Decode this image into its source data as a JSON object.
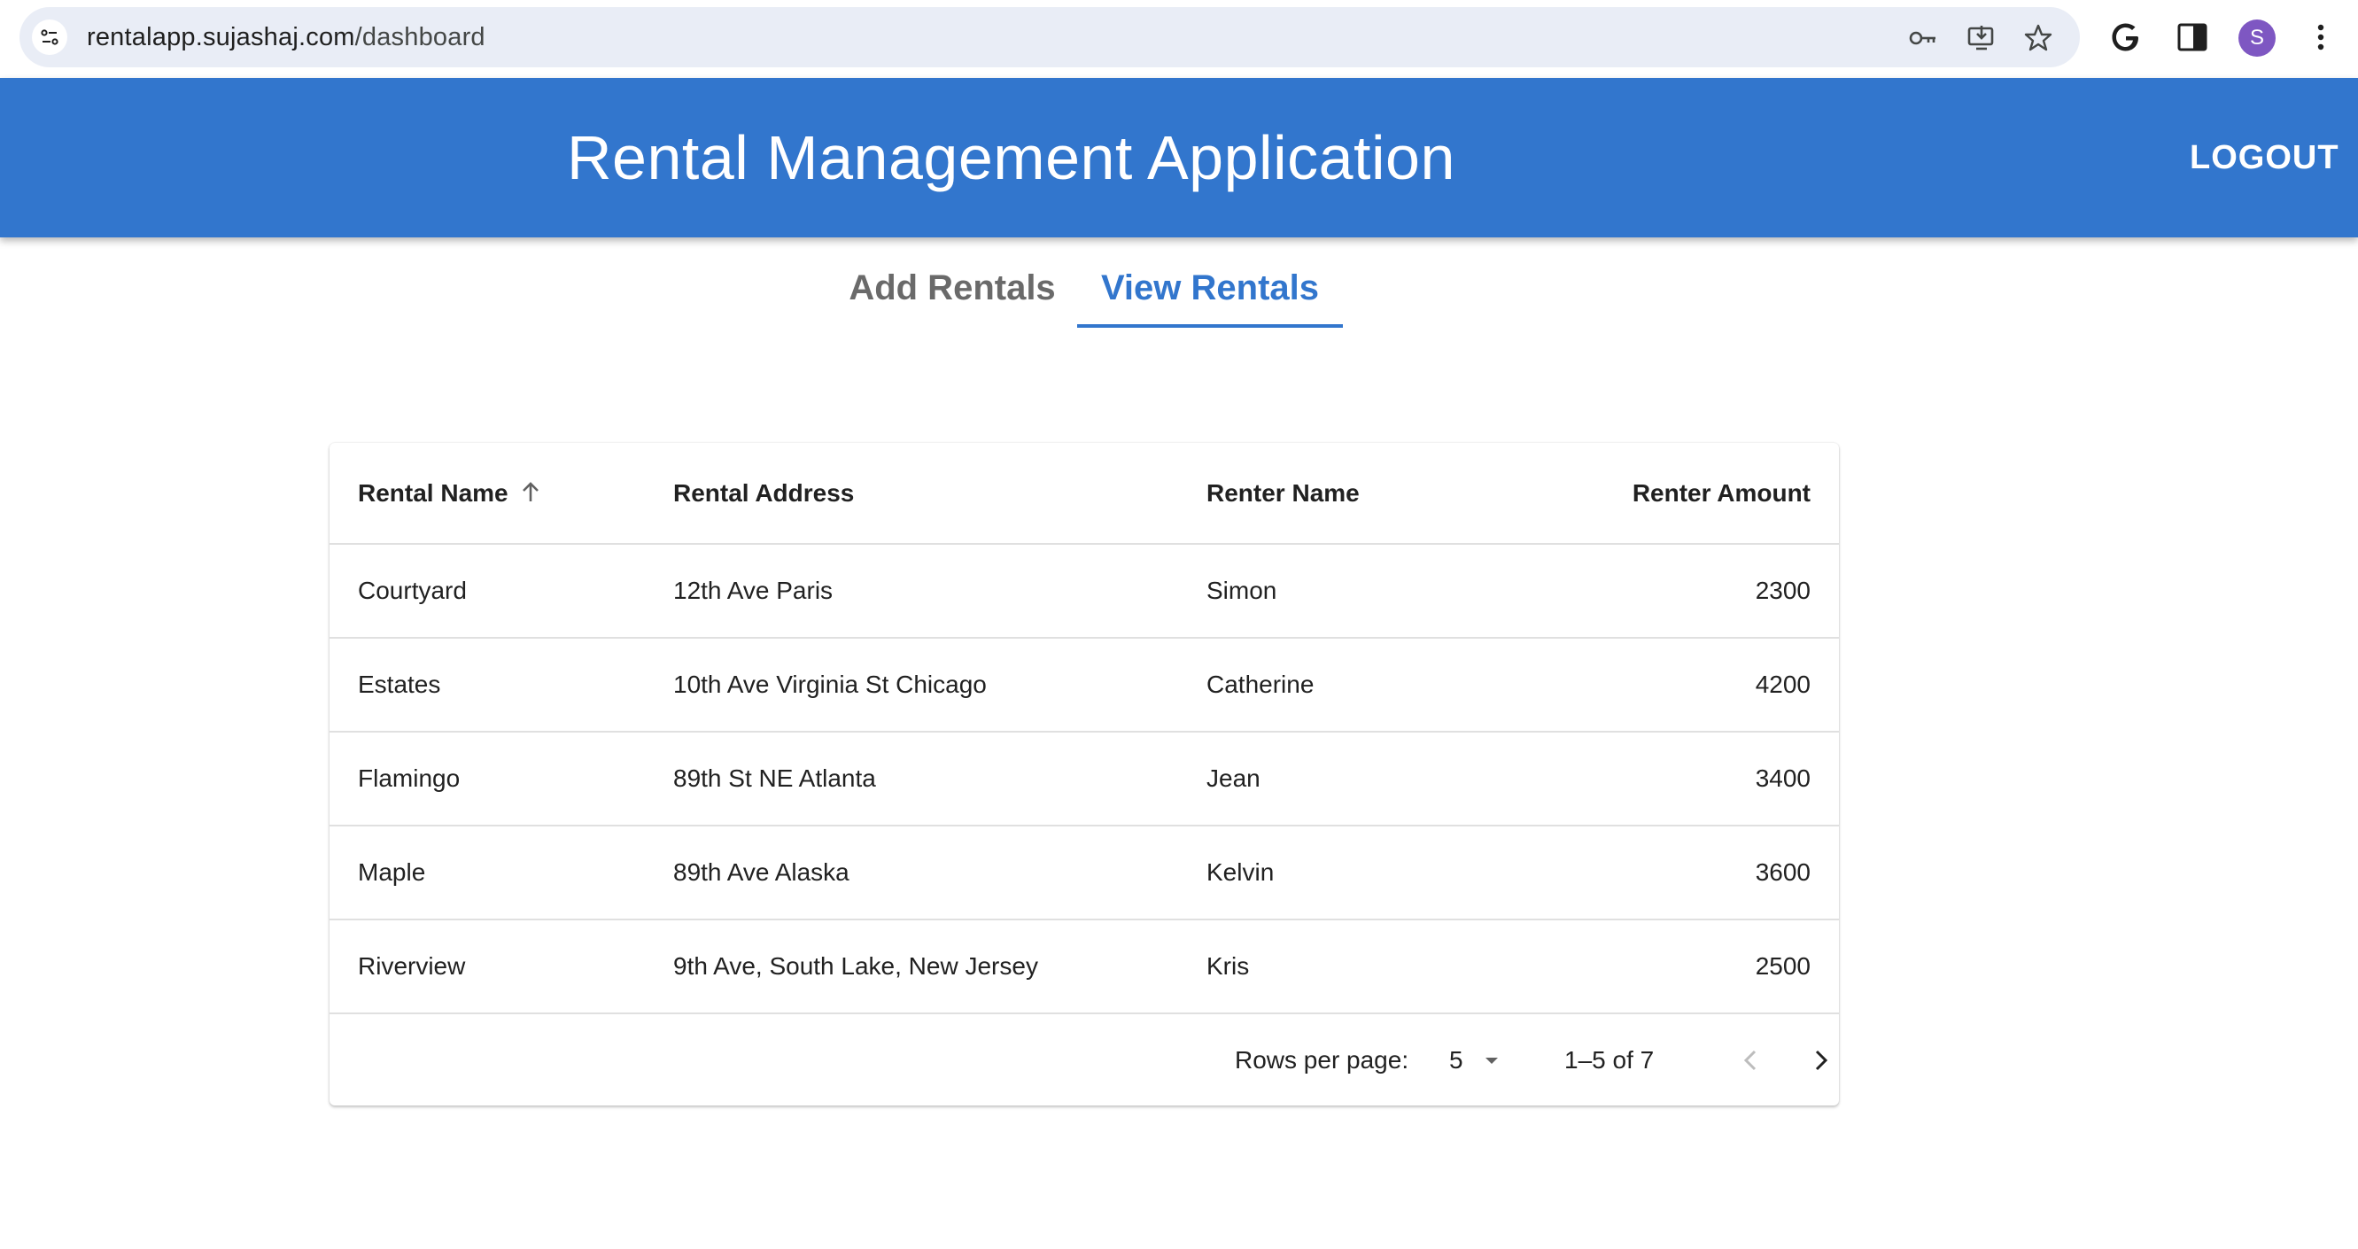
{
  "browser": {
    "url_host": "rentalapp.sujashaj.com",
    "url_path": "/dashboard",
    "profile_initial": "S",
    "icons": [
      "tune-icon",
      "key-icon",
      "install-app-icon",
      "star-icon",
      "google-icon",
      "side-panel-icon",
      "more-vert-icon"
    ]
  },
  "header": {
    "title": "Rental Management Application",
    "logout_label": "LOGOUT",
    "background": "#3276cd"
  },
  "tabs": [
    {
      "label": "Add Rentals",
      "selected": false
    },
    {
      "label": "View Rentals",
      "selected": true
    }
  ],
  "table": {
    "columns": [
      "Rental Name",
      "Rental Address",
      "Renter Name",
      "Renter Amount"
    ],
    "sort": {
      "column": "Rental Name",
      "direction": "ascending"
    },
    "rows": [
      {
        "name": "Courtyard",
        "address": "12th Ave Paris",
        "renter": "Simon",
        "amount": "2300"
      },
      {
        "name": "Estates",
        "address": "10th Ave Virginia St Chicago",
        "renter": "Catherine",
        "amount": "4200"
      },
      {
        "name": "Flamingo",
        "address": "89th St NE Atlanta",
        "renter": "Jean",
        "amount": "3400"
      },
      {
        "name": "Maple",
        "address": "89th Ave Alaska",
        "renter": "Kelvin",
        "amount": "3600"
      },
      {
        "name": "Riverview",
        "address": "9th Ave, South Lake, New Jersey",
        "renter": "Kris",
        "amount": "2500"
      }
    ]
  },
  "pagination": {
    "rows_per_page_label": "Rows per page:",
    "rows_per_page_value": "5",
    "range_label": "1–5 of 7"
  }
}
